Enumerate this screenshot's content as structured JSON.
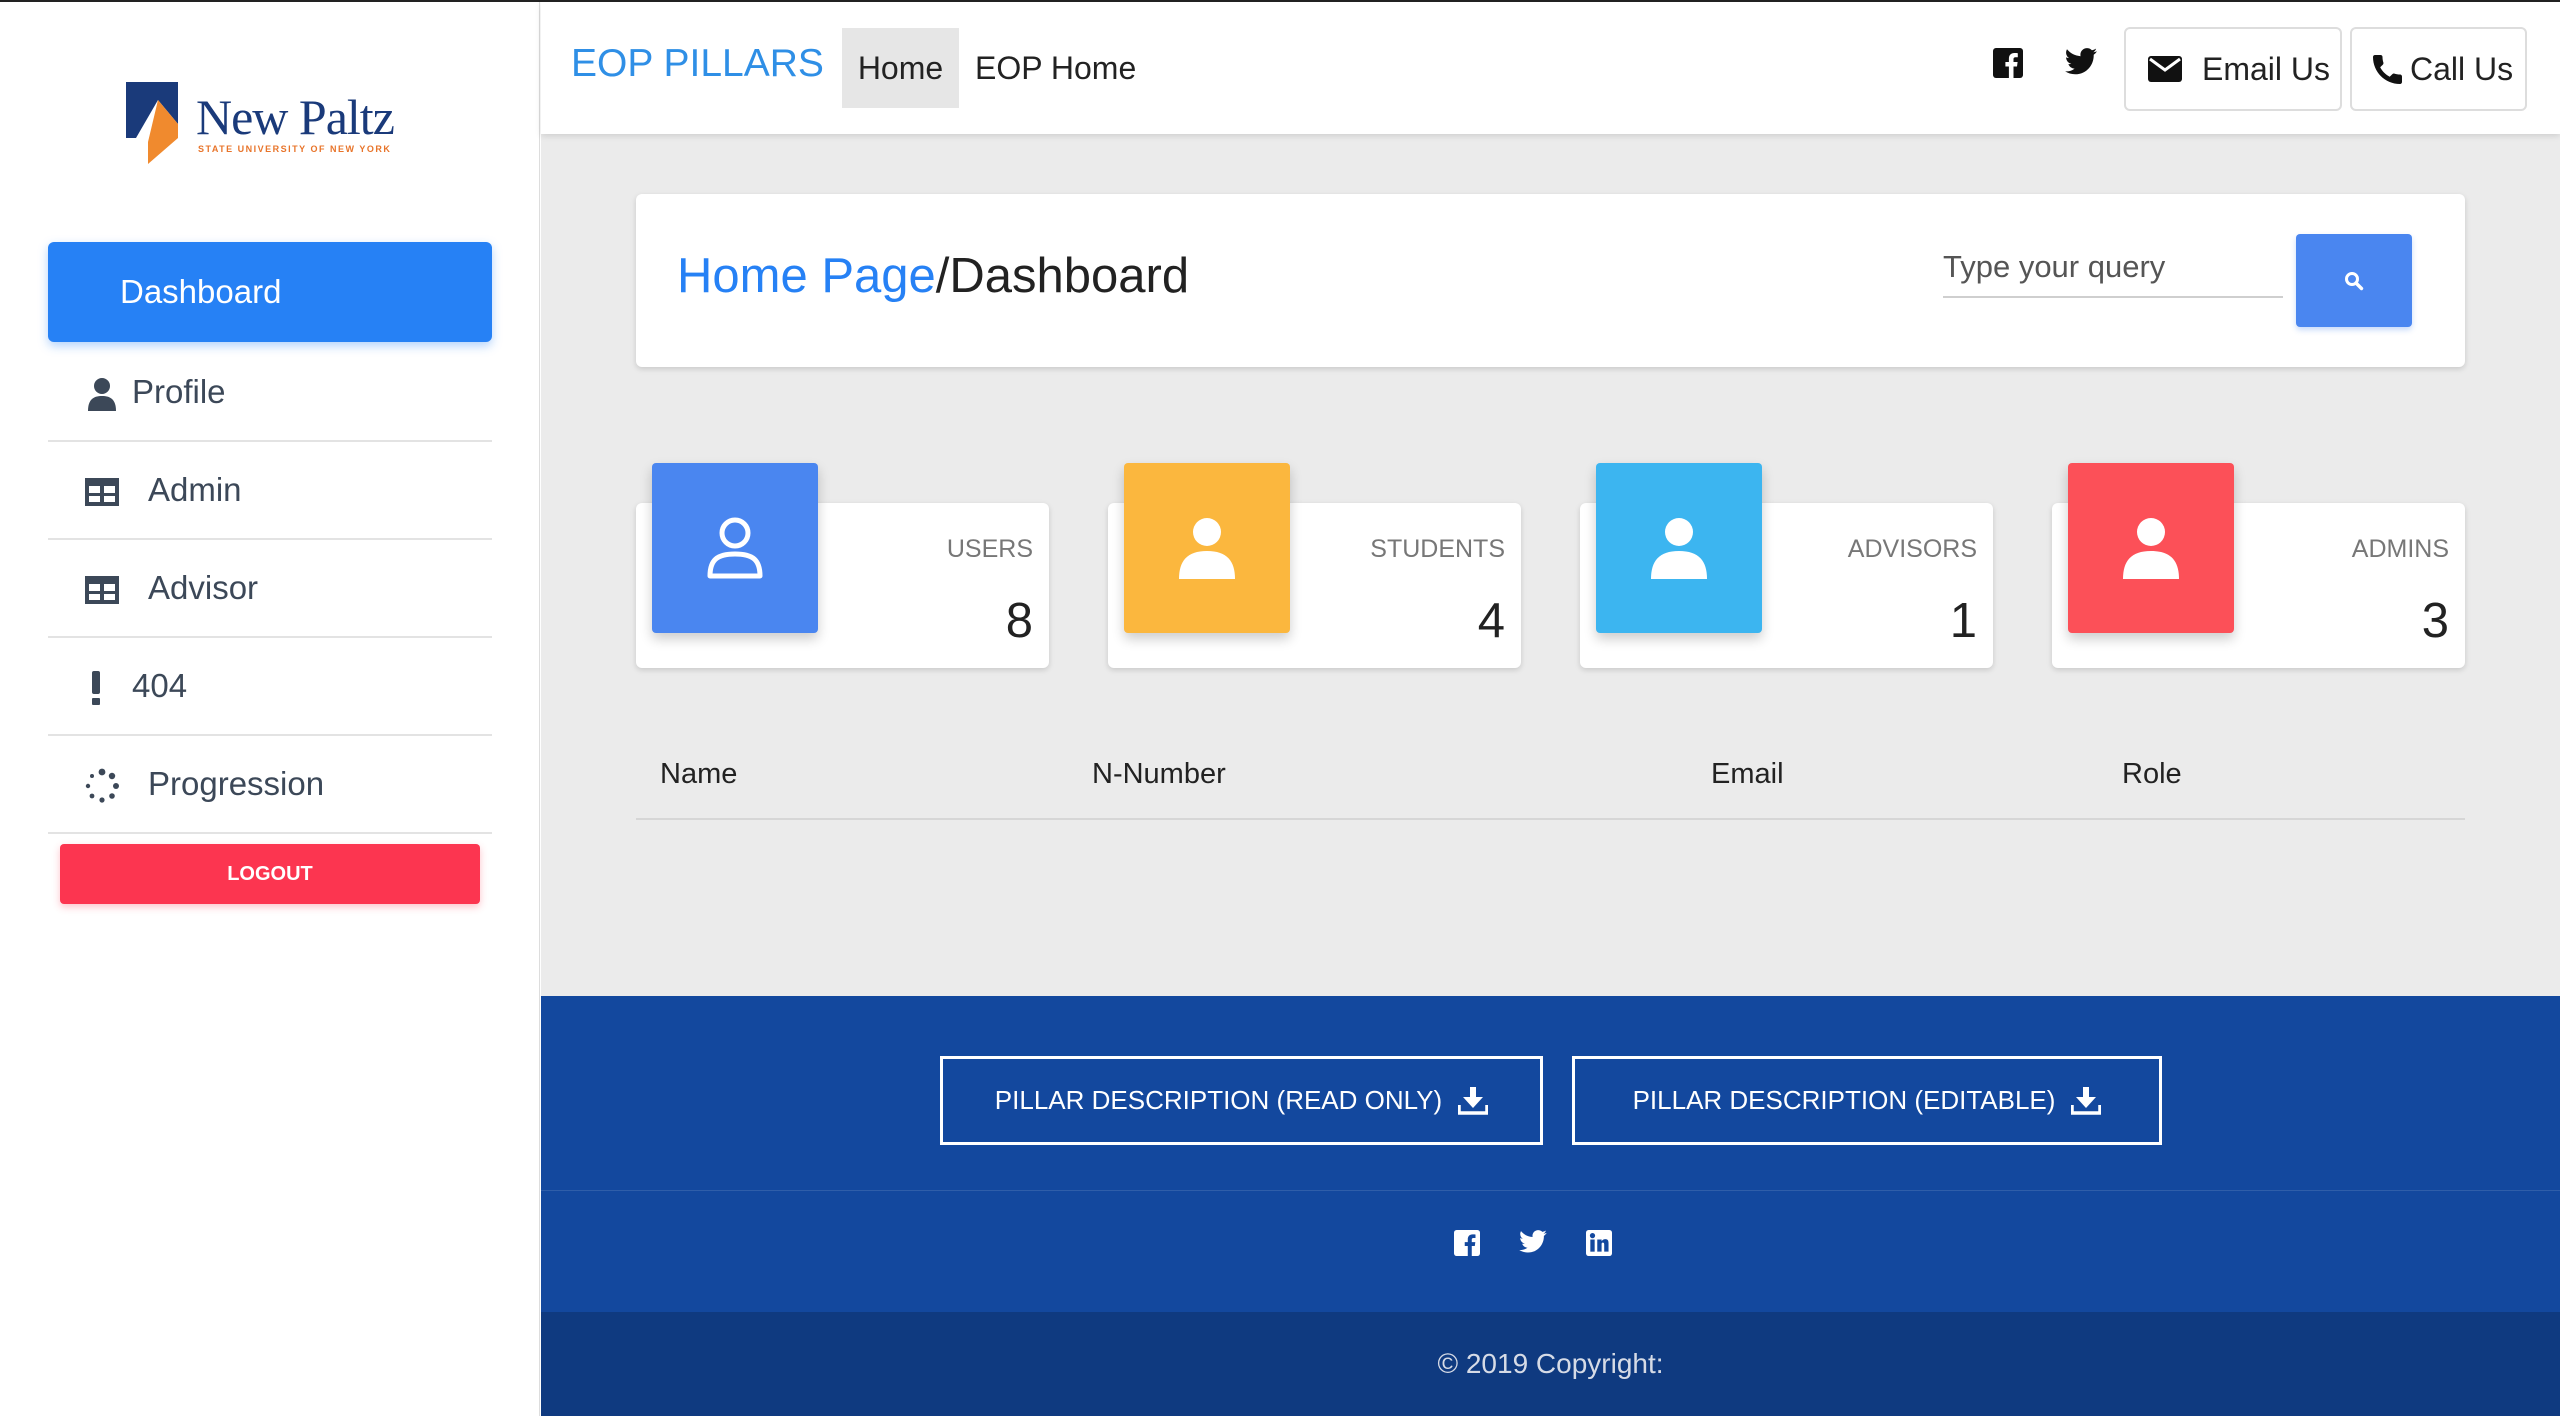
{
  "sidebar": {
    "logo": {
      "text": "New Paltz",
      "subtext": "STATE UNIVERSITY OF NEW YORK"
    },
    "items": [
      {
        "label": "Dashboard",
        "icon": "none",
        "active": true
      },
      {
        "label": "Profile",
        "icon": "person-icon"
      },
      {
        "label": "Admin",
        "icon": "table-icon"
      },
      {
        "label": "Advisor",
        "icon": "table-icon"
      },
      {
        "label": "404",
        "icon": "exclamation-icon"
      },
      {
        "label": "Progression",
        "icon": "spinner-icon"
      }
    ],
    "logout_label": "LOGOUT"
  },
  "navbar": {
    "brand": "EOP PILLARS",
    "tabs": [
      {
        "label": "Home",
        "active": true
      },
      {
        "label": "EOP Home"
      }
    ],
    "email_label": "Email Us",
    "call_label": "Call Us"
  },
  "header": {
    "crumb_link": "Home Page",
    "crumb_current": "/Dashboard",
    "search_placeholder": "Type your query"
  },
  "stats": [
    {
      "label": "USERS",
      "value": "8",
      "color": "#4a86f0",
      "icon": "user-outline-icon"
    },
    {
      "label": "STUDENTS",
      "value": "4",
      "color": "#fbb73e",
      "icon": "user-icon"
    },
    {
      "label": "ADVISORS",
      "value": "1",
      "color": "#3cb5f0",
      "icon": "user-icon"
    },
    {
      "label": "ADMINS",
      "value": "3",
      "color": "#fc5058",
      "icon": "user-icon"
    }
  ],
  "table": {
    "columns": [
      "Name",
      "N-Number",
      "Email",
      "Role"
    ]
  },
  "footer": {
    "button_readonly": "PILLAR DESCRIPTION (READ ONLY)",
    "button_editable": "PILLAR DESCRIPTION (EDITABLE)",
    "copyright": "© 2019 Copyright:"
  },
  "colors": {
    "primary": "#2681f5",
    "logout": "#fc3550",
    "footer": "#13489e",
    "footer_bottom": "#0f3a80"
  }
}
